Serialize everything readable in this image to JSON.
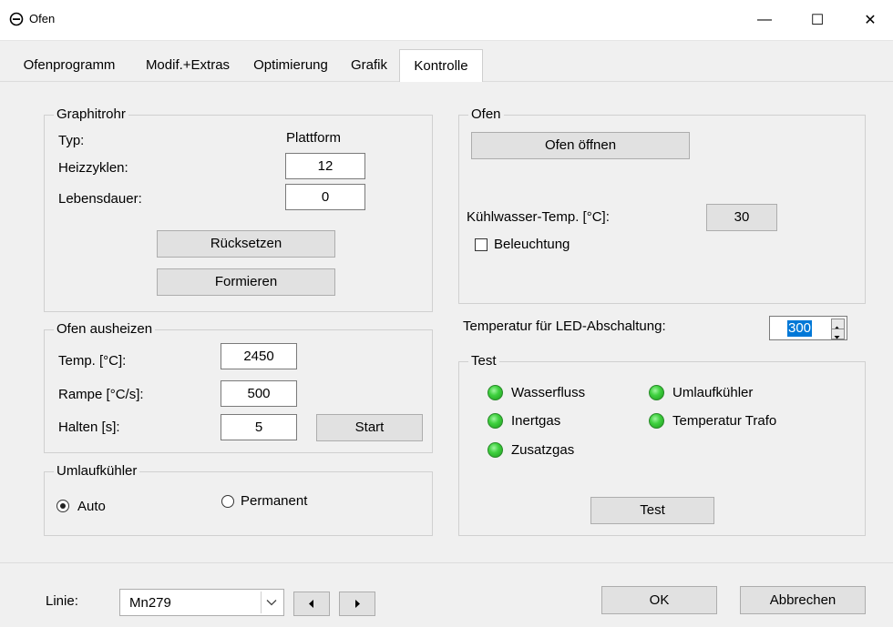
{
  "window": {
    "title": "Ofen",
    "minimize": "—",
    "maximize": "☐",
    "close": "✕"
  },
  "tabs": [
    {
      "label": "Ofenprogramm"
    },
    {
      "label": "Modif.+Extras"
    },
    {
      "label": "Optimierung"
    },
    {
      "label": "Grafik"
    },
    {
      "label": "Kontrolle"
    }
  ],
  "graphitrohr": {
    "title": "Graphitrohr",
    "typ_label": "Typ:",
    "typ_value": "Plattform",
    "heizzyklen_label": "Heizzyklen:",
    "heizzyklen_value": "12",
    "lebensdauer_label": "Lebensdauer:",
    "lebensdauer_value": "0",
    "reset_button": "Rücksetzen",
    "form_button": "Formieren"
  },
  "ausheizen": {
    "title": "Ofen ausheizen",
    "temp_label": "Temp. [°C]:",
    "temp_value": "2450",
    "rampe_label": "Rampe [°C/s]:",
    "rampe_value": "500",
    "halten_label": "Halten [s]:",
    "halten_value": "5",
    "start_button": "Start"
  },
  "umlaufkuehler": {
    "title": "Umlaufkühler",
    "auto_label": "Auto",
    "permanent_label": "Permanent",
    "selected": "Auto"
  },
  "ofen": {
    "title": "Ofen",
    "open_button": "Ofen öffnen",
    "kuehlwasser_label": "Kühlwasser-Temp. [°C]:",
    "kuehlwasser_value": "30",
    "beleuchtung_label": "Beleuchtung",
    "beleuchtung_checked": false
  },
  "led_shutoff": {
    "label": "Temperatur für LED-Abschaltung:",
    "value": "300"
  },
  "test": {
    "title": "Test",
    "indicators": [
      {
        "label": "Wasserfluss",
        "color": "#3fd13f"
      },
      {
        "label": "Inertgas",
        "color": "#3fd13f"
      },
      {
        "label": "Zusatzgas",
        "color": "#3fd13f"
      },
      {
        "label": "Umlaufkühler",
        "color": "#3fd13f"
      },
      {
        "label": "Temperatur Trafo",
        "color": "#3fd13f"
      }
    ],
    "test_button": "Test"
  },
  "footer": {
    "linie_label": "Linie:",
    "linie_value": "Mn279",
    "ok_button": "OK",
    "cancel_button": "Abbrechen"
  }
}
